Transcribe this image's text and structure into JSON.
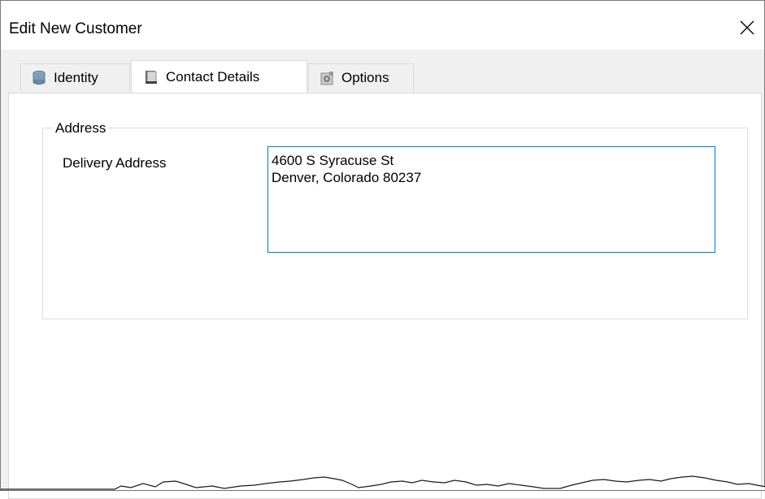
{
  "window": {
    "title": "Edit New Customer"
  },
  "tabs": [
    {
      "label": "Identity",
      "icon": "database-icon"
    },
    {
      "label": "Contact Details",
      "icon": "address-book-icon",
      "active": true
    },
    {
      "label": "Options",
      "icon": "options-gear-icon"
    }
  ],
  "address_group": {
    "legend": "Address",
    "delivery_label": "Delivery Address",
    "delivery_value": "4600 S Syracuse St\nDenver, Colorado 80237"
  },
  "colors": {
    "focus_border": "#0078d7",
    "tab_border": "#d9d9d9",
    "background": "#f0f0f0"
  }
}
